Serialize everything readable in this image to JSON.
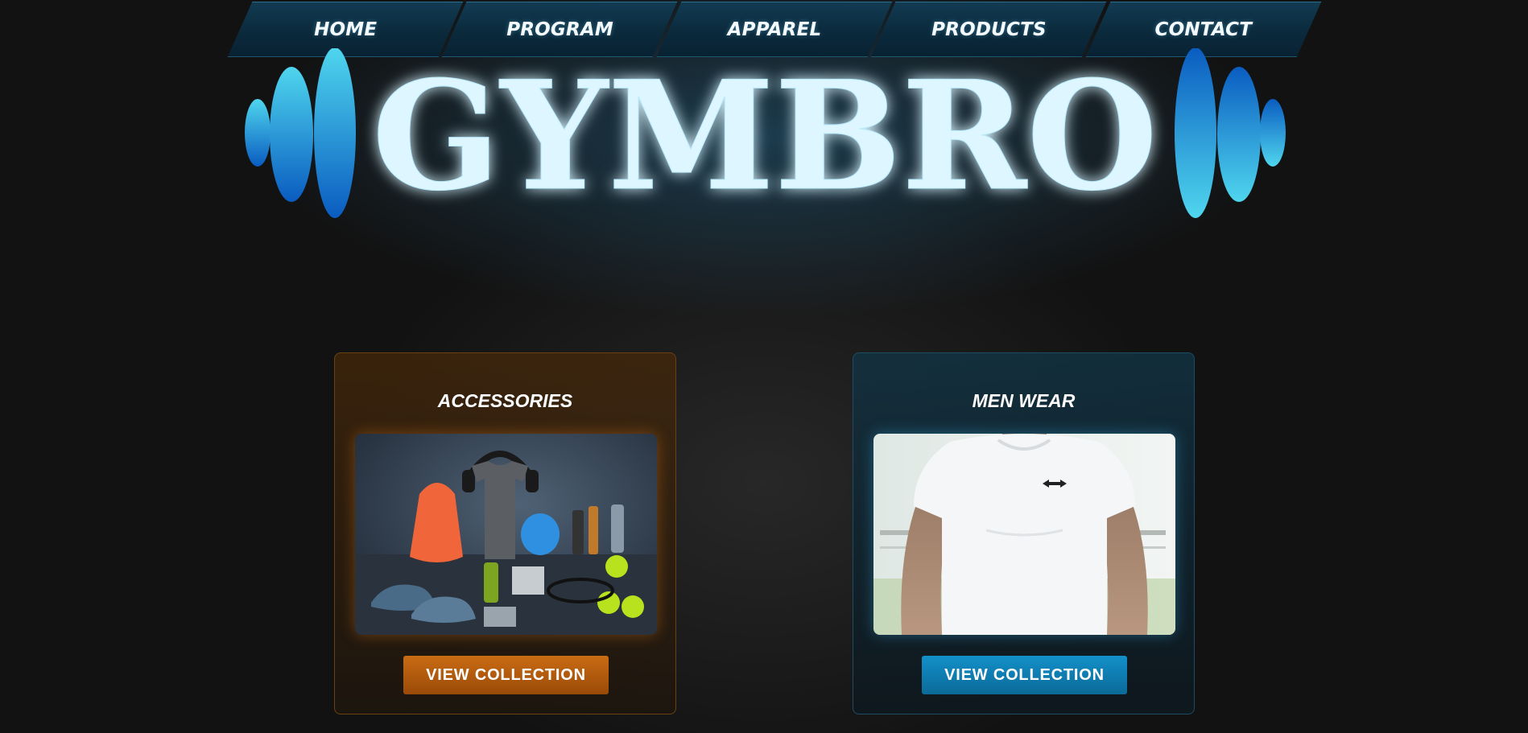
{
  "nav": {
    "items": [
      {
        "label": "HOME"
      },
      {
        "label": "PROGRAM"
      },
      {
        "label": "APPAREL"
      },
      {
        "label": "PRODUCTS"
      },
      {
        "label": "CONTACT"
      }
    ]
  },
  "logo": {
    "text": "GYMBRO",
    "icon_left": "dumbbell-plates-icon",
    "icon_right": "dumbbell-plates-icon"
  },
  "cards": [
    {
      "title": "ACCESSORIES",
      "image": "gym-accessories-photo",
      "button_label": "VIEW COLLECTION",
      "accent_color": "#c96c14"
    },
    {
      "title": "MEN WEAR",
      "image": "men-tshirt-photo",
      "button_label": "VIEW COLLECTION",
      "accent_color": "#1390c9"
    }
  ],
  "colors": {
    "background": "#121212",
    "logo_fill": "#ddf6ff",
    "logo_glow": "#3fc8f0"
  }
}
